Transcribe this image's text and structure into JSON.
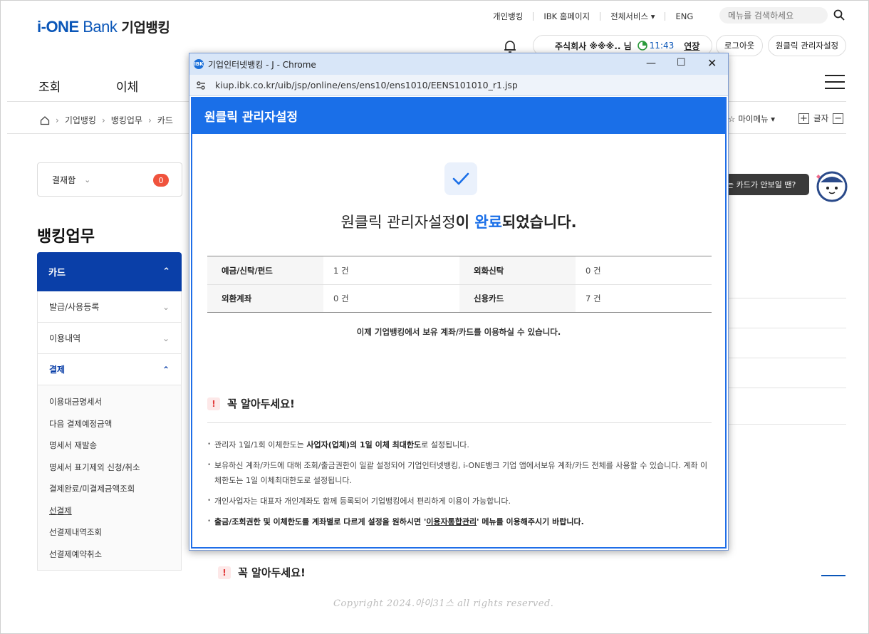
{
  "header": {
    "logo_main": "i-ONE",
    "logo_bank": "Bank",
    "logo_kr": "기업뱅킹",
    "topnav": [
      "개인뱅킹",
      "IBK 홈페이지",
      "전체서비스 ▾",
      "ENG"
    ],
    "search_placeholder": "메뉴를 검색하세요",
    "user_company": "주식회사 ※※※.. 님",
    "timer": "11:43",
    "extend": "연장",
    "logout": "로그아웃",
    "oneclick": "원클릭 관리자설정",
    "gnb": [
      "조회",
      "이체"
    ]
  },
  "breadcrumb": [
    "기업뱅킹",
    "뱅킹업무",
    "카드"
  ],
  "mymenu": "마이메뉴 ▾",
  "fontsize_label": "글자",
  "sidebar": {
    "payment_label": "결재함",
    "payment_count": "0",
    "title": "뱅킹업무",
    "category": "카드",
    "items": [
      "발급/사용등록",
      "이용내역",
      "결제"
    ],
    "subitems": [
      "이용대금명세서",
      "다음 결제예정금액",
      "명세서 재발송",
      "명세서 표기제외 신청/취소",
      "결제완료/미결제금액조회",
      "선결제",
      "선결제내역조회",
      "선결제예약취소"
    ]
  },
  "tooltip": "는 카드가 안보일 땐?",
  "bottom_notice": "꼭 알아두세요!",
  "copyright": "Copyright 2024.아이31스 all rights reserved.",
  "popup": {
    "window_title": "기업인터넷뱅킹 - J - Chrome",
    "url": "kiup.ibk.co.kr/uib/jsp/online/ens/ens10/ens1010/EENS101010_r1.jsp",
    "heading": "원클릭 관리자설정",
    "done_part1": "원클릭 관리자설정",
    "done_part2": "이 ",
    "done_part3": "완료",
    "done_part4": "되었습니다.",
    "table": [
      [
        {
          "label": "예금/신탁/펀드",
          "value": "1 건"
        },
        {
          "label": "외화신탁",
          "value": "0 건"
        }
      ],
      [
        {
          "label": "외환계좌",
          "value": "0 건"
        },
        {
          "label": "신용카드",
          "value": "7 건"
        }
      ]
    ],
    "use_note": "이제 기업뱅킹에서 보유 계좌/카드를 이용하실 수 있습니다.",
    "notice_title": "꼭 알아두세요!",
    "note1_a": "관리자 1일/1회 이체한도는 ",
    "note1_b": "사업자(업체)의 1일 이체 최대한도",
    "note1_c": "로 설정됩니다.",
    "note2": "보유하신 계좌/카드에 대해 조회/출금권한이 일괄 설정되어 기업인터넷뱅킹, i-ONE뱅크 기업 앱에서보유 계좌/카드 전체를 사용할 수 있습니다. 계좌 이체한도는 1일 이체최대한도로 설정됩니다.",
    "note3": "개인사업자는 대표자 개인계좌도 함께 등록되어 기업뱅킹에서 편리하게 이용이 가능합니다.",
    "note4_a": "출금/조회권한 및 이체한도를 계좌별로 다르게 설정을 원하시면 '",
    "note4_b": "이용자통합관리",
    "note4_c": "' 메뉴를 이용해주시기 바랍니다."
  }
}
